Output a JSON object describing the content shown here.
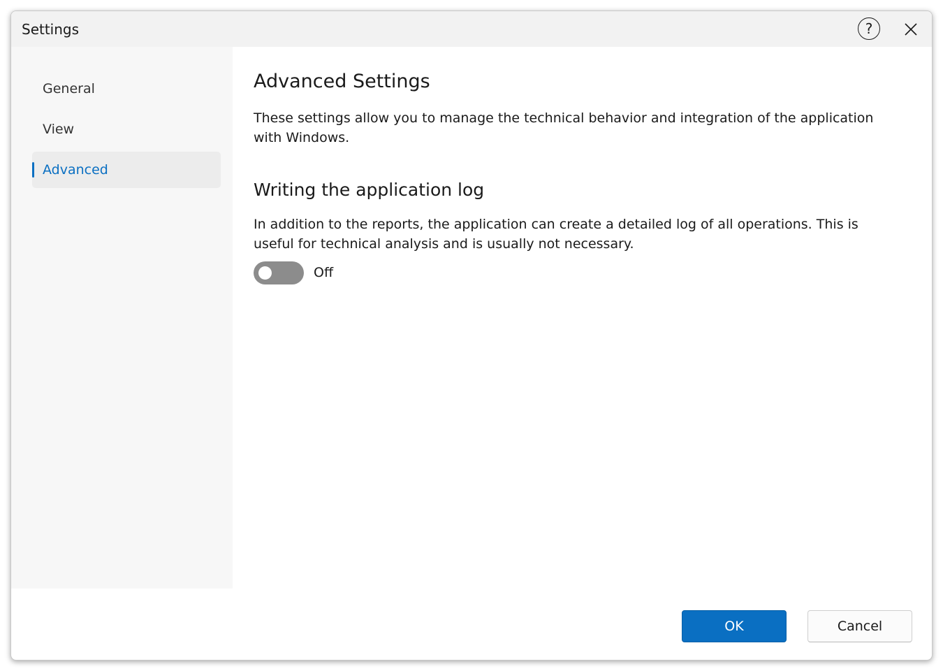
{
  "window": {
    "title": "Settings"
  },
  "titlebar": {
    "help_glyph": "?",
    "help_icon": "help-circle-icon",
    "close_icon": "close-icon"
  },
  "sidebar": {
    "items": [
      {
        "label": "General",
        "active": false
      },
      {
        "label": "View",
        "active": false
      },
      {
        "label": "Advanced",
        "active": true
      }
    ]
  },
  "content": {
    "heading": "Advanced Settings",
    "description": "These settings allow you to manage the technical behavior and integration of the application with Windows.",
    "log_section": {
      "heading": "Writing the application log",
      "description": "In addition to the reports, the application can create a detailed log of all operations. This is useful for technical analysis and is usually not necessary.",
      "toggle_on": false,
      "toggle_state_label": "Off"
    }
  },
  "buttons": {
    "ok_label": "OK",
    "cancel_label": "Cancel"
  },
  "colors": {
    "accent": "#0a6fc2",
    "toggle_off": "#8c8c8c"
  }
}
